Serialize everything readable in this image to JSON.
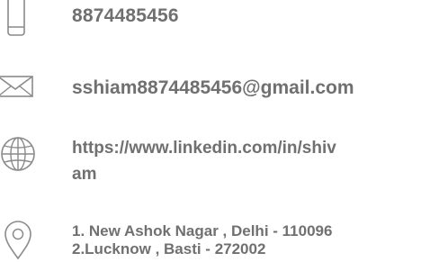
{
  "contact": {
    "phone": "8874485456",
    "email": "sshiam8874485456@gmail.com",
    "website_line1": "https://www.linkedin.com/in/shiv",
    "website_line2": "am",
    "address_line1": "1. New Ashok Nagar , Delhi - 110096",
    "address_line2": "2.Lucknow , Basti - 272002"
  },
  "icons": [
    "phone-icon",
    "mail-icon",
    "globe-icon",
    "location-pin-icon"
  ],
  "colors": {
    "text": "#707070",
    "icon": "#8a8a8a"
  }
}
